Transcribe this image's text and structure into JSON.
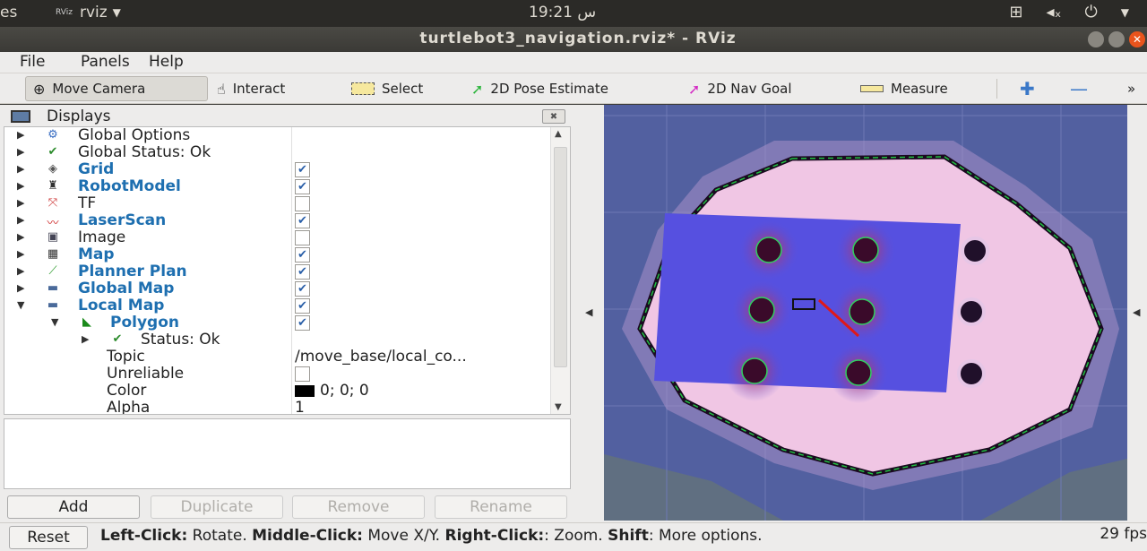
{
  "topbar": {
    "left_fragment": "es",
    "app_name": "rviz",
    "clock": "19:21 س"
  },
  "window": {
    "title": "turtlebot3_navigation.rviz* - RViz"
  },
  "menu": {
    "file": "File",
    "panels": "Panels",
    "help": "Help"
  },
  "toolbar": {
    "move_camera": "Move Camera",
    "interact": "Interact",
    "select": "Select",
    "pose_estimate": "2D Pose Estimate",
    "nav_goal": "2D Nav Goal",
    "measure": "Measure",
    "more": "»"
  },
  "displays": {
    "title": "Displays",
    "rows": [
      {
        "name": "Global Options"
      },
      {
        "name": "Global Status: Ok"
      },
      {
        "name": "Grid"
      },
      {
        "name": "RobotModel"
      },
      {
        "name": "TF"
      },
      {
        "name": "LaserScan"
      },
      {
        "name": "Image"
      },
      {
        "name": "Map"
      },
      {
        "name": "Planner Plan"
      },
      {
        "name": "Global Map"
      },
      {
        "name": "Local Map"
      },
      {
        "name": "Polygon"
      },
      {
        "name": "Status: Ok"
      },
      {
        "name": "Topic",
        "value": "/move_base/local_co..."
      },
      {
        "name": "Unreliable"
      },
      {
        "name": "Color",
        "value": "0; 0; 0"
      },
      {
        "name": "Alpha",
        "value": "1"
      }
    ],
    "checked": {
      "grid": true,
      "robotmodel": true,
      "tf": false,
      "laserscan": true,
      "image": false,
      "map": true,
      "planner_plan": true,
      "global_map": true,
      "local_map": true,
      "polygon": true,
      "unreliable": false
    }
  },
  "buttons": {
    "add": "Add",
    "duplicate": "Duplicate",
    "remove": "Remove",
    "rename": "Rename"
  },
  "status": {
    "reset": "Reset",
    "left_click": "Left-Click:",
    "rotate": " Rotate. ",
    "middle_click": "Middle-Click:",
    "move": " Move X/Y. ",
    "right_click": "Right-Click:",
    "zoom": ": Zoom. ",
    "shift": "Shift",
    "more": ": More options.",
    "fps": "29 fps"
  },
  "colors": {
    "accent_blue": "#1e6fb0",
    "close_button": "#e9541d",
    "costmap_blue": "#4f5a9c"
  }
}
